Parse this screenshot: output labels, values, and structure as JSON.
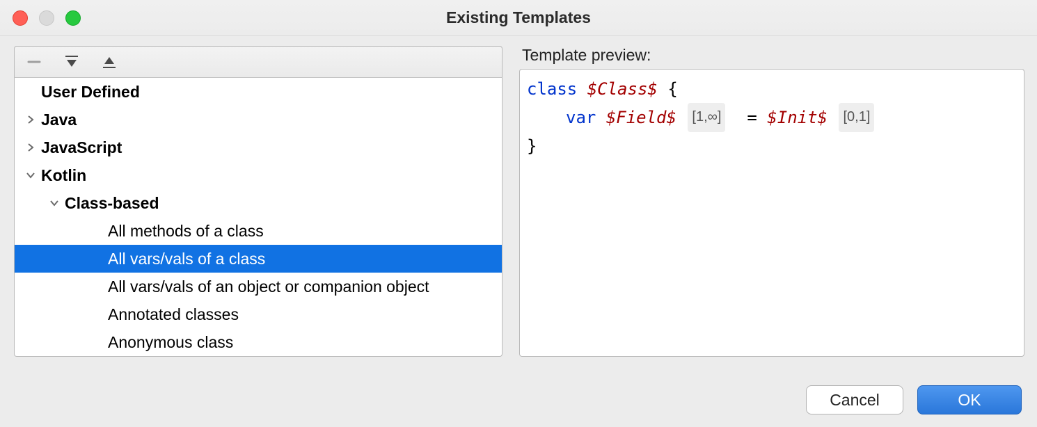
{
  "window": {
    "title": "Existing Templates"
  },
  "toolbar": {
    "remove_icon": "remove",
    "expand_icon": "expand-all",
    "collapse_icon": "collapse-all"
  },
  "tree": [
    {
      "label": "User Defined",
      "indent": 0,
      "arrow": "none",
      "bold": true,
      "selected": false
    },
    {
      "label": "Java",
      "indent": 0,
      "arrow": "right",
      "bold": true,
      "selected": false
    },
    {
      "label": "JavaScript",
      "indent": 0,
      "arrow": "right",
      "bold": true,
      "selected": false
    },
    {
      "label": "Kotlin",
      "indent": 0,
      "arrow": "down",
      "bold": true,
      "selected": false
    },
    {
      "label": "Class-based",
      "indent": 1,
      "arrow": "down",
      "bold": true,
      "selected": false
    },
    {
      "label": "All methods of a class",
      "indent": 2,
      "arrow": "none",
      "bold": false,
      "selected": false
    },
    {
      "label": "All vars/vals of a class",
      "indent": 2,
      "arrow": "none",
      "bold": false,
      "selected": true
    },
    {
      "label": "All vars/vals of an object or companion object",
      "indent": 2,
      "arrow": "none",
      "bold": false,
      "selected": false
    },
    {
      "label": "Annotated classes",
      "indent": 2,
      "arrow": "none",
      "bold": false,
      "selected": false
    },
    {
      "label": "Anonymous class",
      "indent": 2,
      "arrow": "none",
      "bold": false,
      "selected": false
    }
  ],
  "preview": {
    "label": "Template preview:",
    "line1": {
      "kw": "class",
      "var": "$Class$",
      "tail": "{"
    },
    "line2": {
      "kw": "var",
      "var1": "$Field$",
      "hint1": "[1,∞]",
      "eq": "=",
      "var2": "$Init$",
      "hint2": "[0,1]"
    },
    "line3": "}"
  },
  "buttons": {
    "cancel": "Cancel",
    "ok": "OK"
  }
}
